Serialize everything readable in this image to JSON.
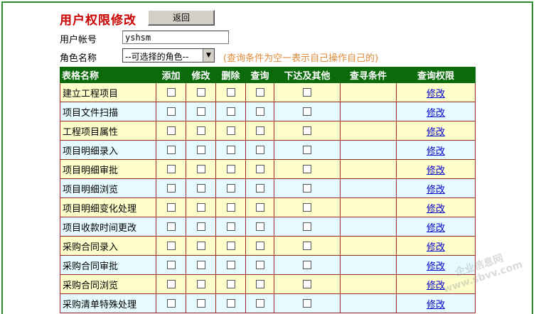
{
  "header": {
    "title": "用户权限修改",
    "back_label": "返回"
  },
  "form": {
    "account_label": "用户帐号",
    "account_value": "yshsm",
    "role_label": "角色名称",
    "role_selected": "--可选择的角色--",
    "hint": "(查询条件为空一表示自己操作自己的)"
  },
  "table": {
    "headers": [
      "表格名称",
      "添加",
      "修改",
      "删除",
      "查询",
      "下达及其他",
      "查寻条件",
      "查询权限"
    ],
    "edit_link_label": "修改",
    "rows": [
      {
        "name": "建立工程项目"
      },
      {
        "name": "项目文件扫描"
      },
      {
        "name": "工程项目属性"
      },
      {
        "name": "项目明细录入"
      },
      {
        "name": "项目明细审批"
      },
      {
        "name": "项目明细浏览"
      },
      {
        "name": "项目明细变化处理"
      },
      {
        "name": "项目收款时间更改"
      },
      {
        "name": "采购合同录入"
      },
      {
        "name": "采购合同审批"
      },
      {
        "name": "采购合同浏览"
      },
      {
        "name": "采购清单特殊处理"
      }
    ]
  },
  "colors": {
    "header_bg": "#0b6b0b",
    "title": "#cc0000",
    "row_odd": "#ffffcc",
    "row_even": "#e6fbff",
    "hint": "#e08a3a"
  }
}
